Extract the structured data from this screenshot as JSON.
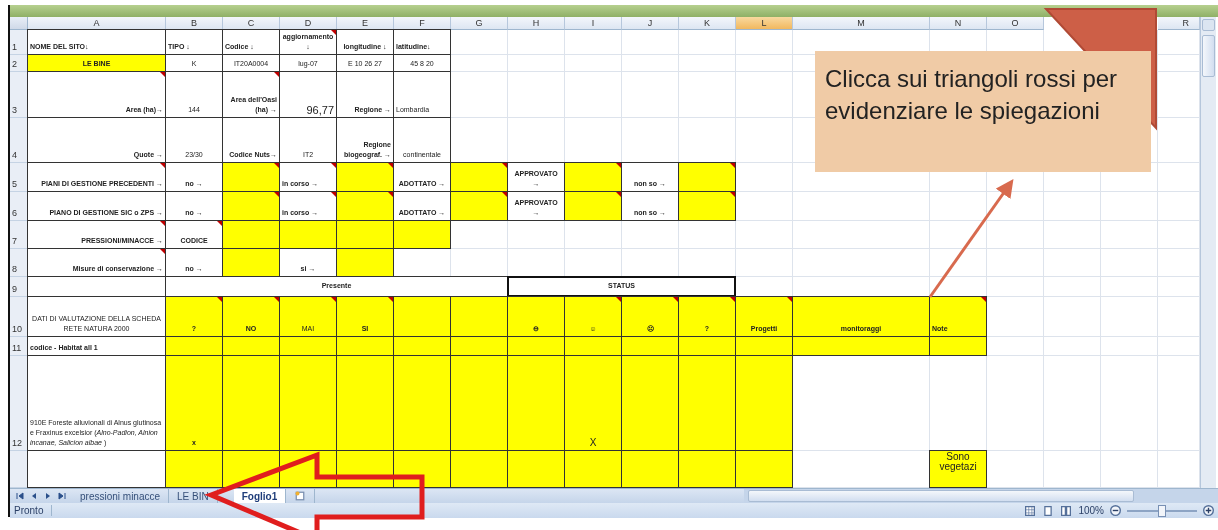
{
  "columns": [
    {
      "kind": "header",
      "label": "A",
      "selected": false
    },
    {
      "kind": "header",
      "label": "B",
      "selected": false
    },
    {
      "kind": "header",
      "label": "C",
      "selected": false
    },
    {
      "kind": "header",
      "label": "D",
      "selected": false
    },
    {
      "kind": "header",
      "label": "E",
      "selected": false
    },
    {
      "kind": "header",
      "label": "F",
      "selected": false
    },
    {
      "kind": "header",
      "label": "G",
      "selected": false
    },
    {
      "kind": "header",
      "label": "H",
      "selected": false
    },
    {
      "kind": "header",
      "label": "I",
      "selected": false
    },
    {
      "kind": "header",
      "label": "J",
      "selected": false
    },
    {
      "kind": "header",
      "label": "K",
      "selected": false
    },
    {
      "kind": "header",
      "label": "L",
      "selected": true
    },
    {
      "kind": "header",
      "label": "M",
      "selected": false
    },
    {
      "kind": "header",
      "label": "N",
      "selected": false
    },
    {
      "kind": "header",
      "label": "O",
      "selected": false
    },
    {
      "kind": "covered"
    },
    {
      "kind": "covered"
    },
    {
      "kind": "header",
      "label": "R",
      "selected": false
    }
  ],
  "rows": [
    {
      "number": "1",
      "cells": [
        {
          "text": "NOME DEL SITO↓",
          "kind": "heading",
          "highlighted": false,
          "comment": false
        },
        {
          "text": "TIPO ↓",
          "kind": "heading",
          "highlighted": false,
          "comment": false
        },
        {
          "text": "Codice ↓",
          "kind": "heading",
          "highlighted": false,
          "comment": false
        },
        {
          "text": "aggiornamento ↓",
          "kind": "bold-value",
          "highlighted": false,
          "comment": true
        },
        {
          "text": "longitudine ↓",
          "kind": "bold-value",
          "highlighted": false,
          "comment": false
        },
        {
          "text": "latitudine↓",
          "kind": "heading",
          "highlighted": false,
          "comment": false
        }
      ]
    },
    {
      "number": "2",
      "cells": [
        {
          "text": "LE BINE",
          "kind": "bold-value",
          "highlighted": true,
          "comment": false
        },
        {
          "text": "K",
          "kind": "value",
          "highlighted": false,
          "comment": false
        },
        {
          "text": "IT20A0004",
          "kind": "value",
          "highlighted": false,
          "comment": false
        },
        {
          "text": "lug-07",
          "kind": "value",
          "highlighted": false,
          "comment": false
        },
        {
          "text": "E 10 26 27",
          "kind": "value",
          "highlighted": false,
          "comment": false
        },
        {
          "text": "45 8 20",
          "kind": "value",
          "highlighted": false,
          "comment": false
        }
      ]
    },
    {
      "number": "3",
      "cells": [
        {
          "text": "Area (ha)→",
          "kind": "label",
          "highlighted": false,
          "comment": true
        },
        {
          "text": "144",
          "kind": "value",
          "highlighted": false,
          "comment": false
        },
        {
          "text": "Area dell'Oasi (ha) →",
          "kind": "label",
          "highlighted": false,
          "comment": true
        },
        {
          "text": "96,77",
          "kind": "number",
          "highlighted": false,
          "comment": false
        },
        {
          "text": "Regione →",
          "kind": "label",
          "highlighted": false,
          "comment": false
        },
        {
          "text": "Lombardia",
          "kind": "note",
          "highlighted": false,
          "comment": false
        }
      ]
    },
    {
      "number": "4",
      "cells": [
        {
          "text": "Quote →",
          "kind": "label",
          "highlighted": false,
          "comment": false
        },
        {
          "text": "23/30",
          "kind": "value",
          "highlighted": false,
          "comment": false
        },
        {
          "text": "Codice Nuts→",
          "kind": "label",
          "highlighted": false,
          "comment": false
        },
        {
          "text": "IT2",
          "kind": "value",
          "highlighted": false,
          "comment": false
        },
        {
          "text": "Regione biogeograf. →",
          "kind": "label",
          "highlighted": false,
          "comment": false
        },
        {
          "text": "continentale",
          "kind": "value",
          "highlighted": false,
          "comment": false
        }
      ]
    },
    {
      "number": "5",
      "cells": [
        {
          "text": "PIANI DI GESTIONE PRECEDENTI →",
          "kind": "label",
          "highlighted": false,
          "comment": true
        },
        {
          "text": "no →",
          "kind": "bold-value",
          "highlighted": false,
          "comment": false
        },
        {
          "kind": "value",
          "highlighted": true,
          "comment": true
        },
        {
          "text": "in corso →",
          "kind": "heading",
          "highlighted": false,
          "comment": true
        },
        {
          "kind": "value",
          "highlighted": true,
          "comment": true
        },
        {
          "text": "ADOTTATO →",
          "kind": "bold-value",
          "highlighted": false,
          "comment": false
        },
        {
          "kind": "value",
          "highlighted": true,
          "comment": true
        },
        {
          "text": "APPROVATO →",
          "kind": "bold-value",
          "highlighted": false,
          "comment": false
        },
        {
          "kind": "value",
          "highlighted": true,
          "comment": true
        },
        {
          "text": "non so →",
          "kind": "bold-value",
          "highlighted": false,
          "comment": false
        },
        {
          "kind": "value",
          "highlighted": true,
          "comment": true
        }
      ]
    },
    {
      "number": "6",
      "cells": [
        {
          "text": "PIANO DI GESTIONE SIC o ZPS →",
          "kind": "label",
          "highlighted": false,
          "comment": false
        },
        {
          "text": "no →",
          "kind": "bold-value",
          "highlighted": false,
          "comment": false
        },
        {
          "kind": "value",
          "highlighted": true,
          "comment": true
        },
        {
          "text": "in corso →",
          "kind": "heading",
          "highlighted": false,
          "comment": true
        },
        {
          "kind": "value",
          "highlighted": true,
          "comment": true
        },
        {
          "text": "ADOTTATO →",
          "kind": "bold-value",
          "highlighted": false,
          "comment": false
        },
        {
          "kind": "value",
          "highlighted": true,
          "comment": true
        },
        {
          "text": "APPROVATO →",
          "kind": "bold-value",
          "highlighted": false,
          "comment": false
        },
        {
          "kind": "value",
          "highlighted": true,
          "comment": true
        },
        {
          "text": "non so →",
          "kind": "bold-value",
          "highlighted": false,
          "comment": false
        },
        {
          "kind": "value",
          "highlighted": true,
          "comment": true
        }
      ]
    },
    {
      "number": "7",
      "cells": [
        {
          "text": "PRESSIONI/MINACCE →",
          "kind": "label",
          "highlighted": false,
          "comment": true
        },
        {
          "text": "CODICE",
          "kind": "bold-value",
          "highlighted": false,
          "comment": true
        },
        {
          "kind": "value",
          "highlighted": true,
          "comment": false
        },
        {
          "kind": "value",
          "highlighted": true,
          "comment": false
        },
        {
          "kind": "value",
          "highlighted": true,
          "comment": false
        },
        {
          "kind": "value",
          "highlighted": true,
          "comment": false
        }
      ]
    },
    {
      "number": "8",
      "cells": [
        {
          "text": "Misure di conservazione →",
          "kind": "label",
          "highlighted": false,
          "comment": true
        },
        {
          "text": "no →",
          "kind": "bold-value",
          "highlighted": false,
          "comment": false
        },
        {
          "kind": "value",
          "highlighted": true,
          "comment": false
        },
        {
          "text": "si →",
          "kind": "bold-value",
          "highlighted": false,
          "comment": false
        },
        {
          "kind": "value",
          "highlighted": true,
          "comment": false
        }
      ]
    },
    {
      "number": "9",
      "cells": [
        {
          "kind": "value",
          "highlighted": false,
          "comment": false
        },
        {
          "text": "Presente",
          "kind": "bold-value",
          "highlighted": false,
          "comment": false
        },
        {
          "kind": "merged"
        },
        {
          "kind": "merged"
        },
        {
          "kind": "merged"
        },
        {
          "kind": "merged"
        },
        {
          "kind": "merged"
        },
        {
          "text": "STATUS",
          "kind": "group-heading",
          "highlighted": false,
          "comment": false
        },
        {
          "kind": "merged"
        },
        {
          "kind": "merged"
        },
        {
          "kind": "merged"
        }
      ]
    },
    {
      "number": "10",
      "cells": [
        {
          "text": "DATI DI VALUTAZIONE DELLA SCHEDA RETE NATURA 2000",
          "kind": "value",
          "highlighted": false,
          "comment": false
        },
        {
          "text": "?",
          "kind": "bold-value",
          "highlighted": true,
          "comment": true
        },
        {
          "text": "NO",
          "kind": "bold-value",
          "highlighted": true,
          "comment": true
        },
        {
          "text": "MAI",
          "kind": "value",
          "highlighted": true,
          "comment": true
        },
        {
          "text": "SI",
          "kind": "bold-value",
          "highlighted": true,
          "comment": true
        },
        {
          "kind": "value",
          "highlighted": true,
          "comment": false
        },
        {
          "kind": "value",
          "highlighted": true,
          "comment": false
        },
        {
          "text": "⊖",
          "kind": "bold-value",
          "highlighted": true,
          "comment": false
        },
        {
          "text": "☺",
          "kind": "bold-value",
          "highlighted": true,
          "comment": true
        },
        {
          "text": "☹",
          "kind": "bold-value",
          "highlighted": true,
          "comment": true
        },
        {
          "text": "?",
          "kind": "bold-value",
          "highlighted": true,
          "comment": true
        },
        {
          "text": "Progetti",
          "kind": "bold-value",
          "highlighted": true,
          "comment": true
        },
        {
          "text": "monitoraggi",
          "kind": "bold-value",
          "highlighted": true,
          "comment": false
        },
        {
          "text": "Note",
          "kind": "heading",
          "highlighted": true,
          "comment": true
        }
      ]
    },
    {
      "number": "11",
      "cells": [
        {
          "text": "codice - Habitat all 1",
          "kind": "heading",
          "highlighted": false,
          "comment": false
        },
        {
          "kind": "value",
          "highlighted": true,
          "comment": false
        },
        {
          "kind": "value",
          "highlighted": true,
          "comment": false
        },
        {
          "kind": "value",
          "highlighted": true,
          "comment": false
        },
        {
          "kind": "value",
          "highlighted": true,
          "comment": false
        },
        {
          "kind": "value",
          "highlighted": true,
          "comment": false
        },
        {
          "kind": "value",
          "highlighted": true,
          "comment": false
        },
        {
          "kind": "value",
          "highlighted": true,
          "comment": false
        },
        {
          "kind": "value",
          "highlighted": true,
          "comment": false
        },
        {
          "kind": "value",
          "highlighted": true,
          "comment": false
        },
        {
          "kind": "value",
          "highlighted": true,
          "comment": false
        },
        {
          "kind": "value",
          "highlighted": true,
          "comment": false
        },
        {
          "kind": "value",
          "highlighted": true,
          "comment": false
        },
        {
          "kind": "value",
          "highlighted": true,
          "comment": false
        }
      ]
    },
    {
      "number": "12",
      "cells": [
        {
          "text": "910E Foreste alluvionali di Alnus glutinosa e Fraxinus excelsior (*Alno-Padion, Alnion incanae, Salicion albae* )",
          "kind": "note",
          "highlighted": false,
          "comment": false
        },
        {
          "text": "x",
          "kind": "bold-value",
          "highlighted": true,
          "comment": false
        },
        {
          "kind": "value",
          "highlighted": true,
          "comment": false
        },
        {
          "kind": "value",
          "highlighted": true,
          "comment": false
        },
        {
          "kind": "value",
          "highlighted": true,
          "comment": false
        },
        {
          "kind": "value",
          "highlighted": true,
          "comment": false
        },
        {
          "kind": "value",
          "highlighted": true,
          "comment": false
        },
        {
          "kind": "value",
          "highlighted": true,
          "comment": false
        },
        {
          "text": "X",
          "kind": "mark",
          "highlighted": true,
          "comment": false
        },
        {
          "kind": "value",
          "highlighted": true,
          "comment": false
        },
        {
          "kind": "value",
          "highlighted": true,
          "comment": false
        },
        {
          "kind": "value",
          "highlighted": true,
          "comment": false
        }
      ]
    },
    {
      "cells": [
        {
          "kind": "value",
          "highlighted": false,
          "comment": false
        },
        {
          "kind": "value",
          "highlighted": true,
          "comment": false
        },
        {
          "kind": "value",
          "highlighted": true,
          "comment": false
        },
        {
          "kind": "value",
          "highlighted": true,
          "comment": false
        },
        {
          "kind": "value",
          "highlighted": true,
          "comment": false
        },
        {
          "kind": "value",
          "highlighted": true,
          "comment": false
        },
        {
          "kind": "value",
          "highlighted": true,
          "comment": false
        },
        {
          "kind": "value",
          "highlighted": true,
          "comment": false
        },
        {
          "kind": "value",
          "highlighted": true,
          "comment": false
        },
        {
          "kind": "value",
          "highlighted": true,
          "comment": false
        },
        {
          "kind": "value",
          "highlighted": true,
          "comment": false
        },
        {
          "kind": "value",
          "highlighted": true,
          "comment": false
        },
        {
          "kind": "blank",
          "highlighted": false,
          "comment": false
        },
        {
          "text": "Sono vegetazi",
          "kind": "memo",
          "highlighted": true,
          "comment": false
        }
      ]
    }
  ],
  "sheet_tabs": [
    {
      "label": "pressioni minacce",
      "selected": false
    },
    {
      "label": "LE BIN",
      "selected": false
    },
    {
      "label": "Foglio1",
      "selected": true
    }
  ],
  "status_bar": {
    "text": "Pronto",
    "zoom": "100%",
    "zoom_slider": {
      "level": 0.5
    }
  },
  "callout": {
    "text": "Clicca sui triangoli rossi per evidenziare le spiegazioni"
  }
}
